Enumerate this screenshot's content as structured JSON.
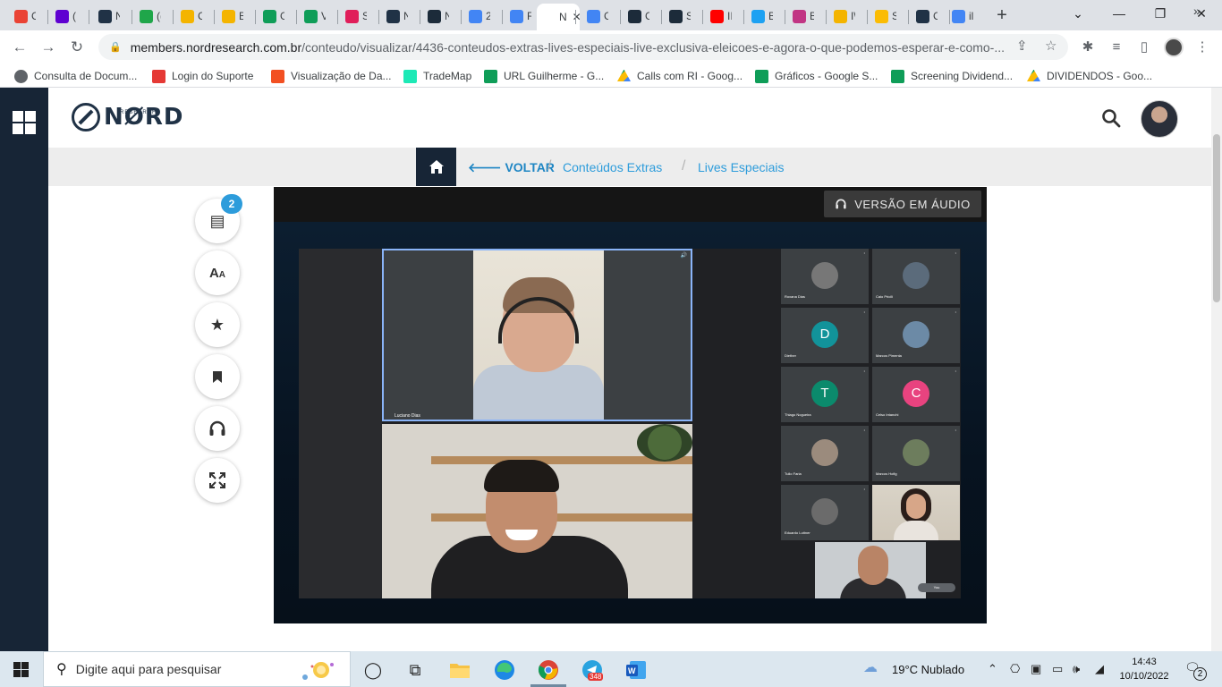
{
  "browser": {
    "tabs": [
      {
        "favicon": "gmail-icon",
        "color": "#ea4335",
        "label": "C"
      },
      {
        "favicon": "mail-icon",
        "color": "#5f01d1",
        "label": "("
      },
      {
        "favicon": "nord-icon",
        "color": "#203246",
        "label": "N"
      },
      {
        "favicon": "number-icon",
        "color": "#1fa64a",
        "label": "(("
      },
      {
        "favicon": "bookmark-yellow-icon",
        "color": "#f4b400",
        "label": "C"
      },
      {
        "favicon": "bookmark-yellow-icon",
        "color": "#f4b400",
        "label": "B"
      },
      {
        "favicon": "sheets-icon",
        "color": "#0f9d58",
        "label": "G"
      },
      {
        "favicon": "sheets-icon",
        "color": "#0f9d58",
        "label": "V"
      },
      {
        "favicon": "slack-icon",
        "color": "#e01e5a",
        "label": "S"
      },
      {
        "favicon": "nord-icon",
        "color": "#203246",
        "label": "N"
      },
      {
        "favicon": "nord-dark-icon",
        "color": "#1c2b3a",
        "label": "N"
      },
      {
        "favicon": "docs-icon",
        "color": "#4285f4",
        "label": "2"
      },
      {
        "favicon": "docs-icon",
        "color": "#4285f4",
        "label": "R"
      },
      {
        "favicon": "active-tab",
        "color": "#ffffff",
        "label": "N"
      },
      {
        "favicon": "docs-icon",
        "color": "#4285f4",
        "label": "C"
      },
      {
        "favicon": "nord-dark-icon",
        "color": "#1c2b3a",
        "label": "C"
      },
      {
        "favicon": "nord-dark-icon",
        "color": "#1c2b3a",
        "label": "S"
      },
      {
        "favicon": "youtube-icon",
        "color": "#ff0000",
        "label": "II"
      },
      {
        "favicon": "twitter-icon",
        "color": "#1da1f2",
        "label": "B"
      },
      {
        "favicon": "instagram-icon",
        "color": "#c13584",
        "label": "B"
      },
      {
        "favicon": "bookmark-yellow-icon",
        "color": "#f4b400",
        "label": "I\\"
      },
      {
        "favicon": "drive-icon",
        "color": "#fbbc04",
        "label": "S"
      },
      {
        "favicon": "nord-icon",
        "color": "#203246",
        "label": "C"
      },
      {
        "favicon": "google-icon",
        "color": "#4285f4",
        "label": "il"
      }
    ],
    "url_host": "members.nordresearch.com.br",
    "url_path": "/conteudo/visualizar/4436-conteudos-extras-lives-especiais-live-exclusiva-eleicoes-e-agora-o-que-podemos-esperar-e-como-...",
    "bookmarks": [
      {
        "icon": "globe-icon",
        "color": "#5f6368",
        "label": "Consulta de Docum..."
      },
      {
        "icon": "support-icon",
        "color": "#e53935",
        "label": "Login do Suporte"
      },
      {
        "icon": "windows-icon",
        "color": "#f25022",
        "label": "Visualização de Da..."
      },
      {
        "icon": "trademap-icon",
        "color": "#1de9b6",
        "label": "TradeMap"
      },
      {
        "icon": "sheets-icon",
        "color": "#0f9d58",
        "label": "URL Guilherme - G..."
      },
      {
        "icon": "drive-icon",
        "color": "#fbbc04",
        "label": "Calls com RI - Goog..."
      },
      {
        "icon": "sheets-icon",
        "color": "#0f9d58",
        "label": "Gráficos - Google S..."
      },
      {
        "icon": "sheets-icon",
        "color": "#0f9d58",
        "label": "Screening Dividend..."
      },
      {
        "icon": "drive-icon",
        "color": "#fbbc04",
        "label": "DIVIDENDOS - Goo..."
      }
    ]
  },
  "site": {
    "logo_text": "NØRD",
    "logo_sub": "RESEARCH",
    "breadcrumb": {
      "back": "VOLTAR",
      "items": [
        "Conteúdos Extras",
        "Lives Especiais"
      ]
    },
    "tools_badge": "2",
    "audio_button": "VERSÃO EM ÁUDIO"
  },
  "meet": {
    "speaker_name": "Luciano Dias",
    "participants": [
      {
        "name": "Roxana Dias",
        "initial": "",
        "avatar_color": "#777777"
      },
      {
        "name": "Caio Pricili",
        "initial": "",
        "avatar_color": "#5b6b7b"
      },
      {
        "name": "Diether",
        "initial": "D",
        "avatar_color": "#12939a"
      },
      {
        "name": "Marcos Pimenta",
        "initial": "",
        "avatar_color": "#6c8aa6"
      },
      {
        "name": "Thiago Nogueira",
        "initial": "T",
        "avatar_color": "#0b8a6c"
      },
      {
        "name": "Celso Intanchi",
        "initial": "C",
        "avatar_color": "#e8437f"
      },
      {
        "name": "Tulio Faria",
        "initial": "",
        "avatar_color": "#9b8b7d"
      },
      {
        "name": "Marcos Hofig",
        "initial": "",
        "avatar_color": "#6d7d5d"
      },
      {
        "name": "Eduardo Luttner",
        "initial": "",
        "avatar_color": "#6b6b6b"
      }
    ],
    "self_label": "You"
  },
  "taskbar": {
    "search_placeholder": "Digite aqui para pesquisar",
    "weather": "19°C  Nublado",
    "time": "14:43",
    "date": "10/10/2022",
    "telegram_badge": "348",
    "notif_count": "2"
  }
}
